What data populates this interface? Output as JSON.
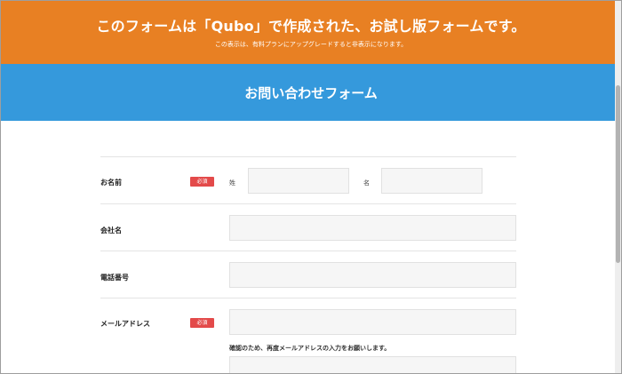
{
  "banner": {
    "title": "このフォームは「Qubo」で作成された、お試し版フォームです。",
    "subtitle": "この表示は、有料プランにアップグレードすると非表示になります。"
  },
  "form": {
    "title": "お問い合わせフォーム",
    "required_badge": "必須",
    "fields": {
      "name": {
        "label": "お名前",
        "last_name_label": "姓",
        "first_name_label": "名"
      },
      "company": {
        "label": "会社名"
      },
      "phone": {
        "label": "電話番号"
      },
      "email": {
        "label": "メールアドレス",
        "confirm_note": "確認のため、再度メールアドレスの入力をお願いします。"
      }
    }
  },
  "colors": {
    "banner": "#e88023",
    "header": "#3599dc",
    "required": "#e34a4a",
    "input_bg": "#f6f6f6"
  }
}
